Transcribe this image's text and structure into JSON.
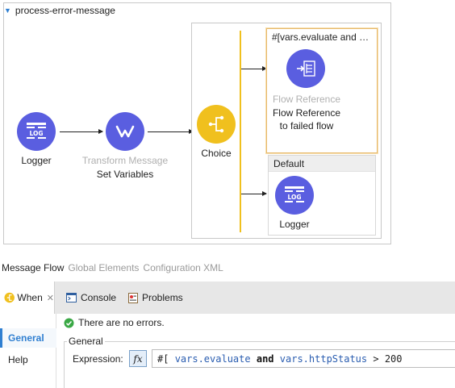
{
  "flow": {
    "name": "process-error-message",
    "nodes": {
      "logger": {
        "badge": "LOG",
        "label": "Logger"
      },
      "transform": {
        "type": "Transform Message",
        "label": "Set Variables"
      },
      "choice": {
        "label": "Choice"
      }
    },
    "routes": {
      "when": {
        "condition": "#[vars.evaluate and vars.httpStatus > 200]",
        "node_type": "Flow Reference",
        "node_label_line1": "Flow Reference",
        "node_label_line2": "to failed flow"
      },
      "default": {
        "title": "Default",
        "node_badge": "LOG",
        "node_label": "Logger"
      }
    }
  },
  "editor_tabs": [
    "Message Flow",
    "Global Elements",
    "Configuration XML"
  ],
  "bottom_panel": {
    "tabs": {
      "when": "When",
      "console": "Console",
      "problems": "Problems"
    },
    "side_nav": [
      "General",
      "Help"
    ],
    "status": "There are no errors.",
    "section": "General",
    "expression_label": "Expression:",
    "fx_label": "fx",
    "expression": {
      "open": "#[ ",
      "t1": "vars.evaluate",
      "kw": "and",
      "t2": "vars.httpStatus",
      "rest": " > 200"
    }
  },
  "colors": {
    "processor": "#5a5ee0",
    "router": "#f0c01e",
    "accent": "#2f7fd1",
    "selected_border": "#e7b86a"
  }
}
